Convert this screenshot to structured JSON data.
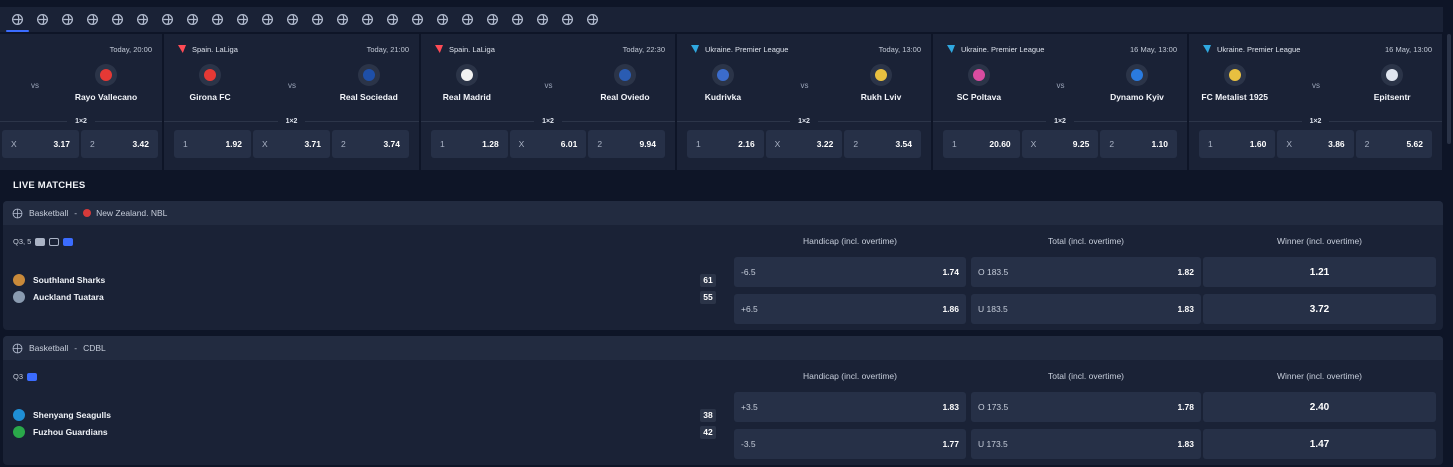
{
  "sports_bar": {
    "icons": [
      "soccer-icon",
      "basketball-icon",
      "tennis-icon",
      "ice-hockey-icon",
      "table-tennis-icon",
      "baseball-icon",
      "volleyball-icon",
      "american-football-icon",
      "handball-icon",
      "cricket-icon",
      "badminton-icon",
      "darts-icon",
      "rugby-icon",
      "boxing-icon",
      "futsal-icon",
      "water-polo-icon",
      "snooker-icon",
      "hockey-stick-icon",
      "golf-icon",
      "esports-icon",
      "chess-icon",
      "trophy-icon",
      "cycling-icon",
      "bicycle-icon"
    ]
  },
  "top_matches": [
    {
      "league": "",
      "date": "Today, 20:00",
      "home": "",
      "away": "Rayo Vallecano",
      "market": "1×2",
      "odds": [
        {
          "l": "X",
          "v": "3.17"
        },
        {
          "l": "2",
          "v": "3.42"
        }
      ],
      "home_color": "",
      "away_color": "#e53935",
      "league_color": ""
    },
    {
      "league": "Spain. LaLiga",
      "date": "Today, 21:00",
      "home": "Girona FC",
      "away": "Real Sociedad",
      "market": "1×2",
      "odds": [
        {
          "l": "1",
          "v": "1.92"
        },
        {
          "l": "X",
          "v": "3.71"
        },
        {
          "l": "2",
          "v": "3.74"
        }
      ],
      "home_color": "#e53935",
      "away_color": "#1e4fa8",
      "league_color": "#ff4b55"
    },
    {
      "league": "Spain. LaLiga",
      "date": "Today, 22:30",
      "home": "Real Madrid",
      "away": "Real Oviedo",
      "market": "1×2",
      "odds": [
        {
          "l": "1",
          "v": "1.28"
        },
        {
          "l": "X",
          "v": "6.01"
        },
        {
          "l": "2",
          "v": "9.94"
        }
      ],
      "home_color": "#f1f1f1",
      "away_color": "#2a5cb3",
      "league_color": "#ff4b55"
    },
    {
      "league": "Ukraine. Premier League",
      "date": "Today, 13:00",
      "home": "Kudrivka",
      "away": "Rukh Lviv",
      "market": "1×2",
      "odds": [
        {
          "l": "1",
          "v": "2.16"
        },
        {
          "l": "X",
          "v": "3.22"
        },
        {
          "l": "2",
          "v": "3.54"
        }
      ],
      "home_color": "#3b6ccc",
      "away_color": "#e8c040",
      "league_color": "#2fa8e0"
    },
    {
      "league": "Ukraine. Premier League",
      "date": "16 May, 13:00",
      "home": "SC Poltava",
      "away": "Dynamo Kyiv",
      "market": "1×2",
      "odds": [
        {
          "l": "1",
          "v": "20.60"
        },
        {
          "l": "X",
          "v": "9.25"
        },
        {
          "l": "2",
          "v": "1.10"
        }
      ],
      "home_color": "#d94ca0",
      "away_color": "#2a7be0",
      "league_color": "#2fa8e0"
    },
    {
      "league": "Ukraine. Premier League",
      "date": "16 May, 13:00",
      "home": "FC Metalist 1925",
      "away": "Epitsentr",
      "market": "1×2",
      "odds": [
        {
          "l": "1",
          "v": "1.60"
        },
        {
          "l": "X",
          "v": "3.86"
        },
        {
          "l": "2",
          "v": "5.62"
        }
      ],
      "home_color": "#e8c040",
      "away_color": "#e0e6f0",
      "league_color": "#2fa8e0"
    }
  ],
  "live": {
    "title": "LIVE MATCHES",
    "sections": [
      {
        "sport": "Basketball",
        "league": "New Zealand. NBL",
        "flag_color": "#d63a3a",
        "period": "Q3, 5",
        "columns": [
          "Handicap (incl. overtime)",
          "Total (incl. overtime)",
          "Winner (incl. overtime)"
        ],
        "teams": [
          {
            "name": "Southland Sharks",
            "score": "61",
            "color": "#c98a3a"
          },
          {
            "name": "Auckland Tuatara",
            "score": "55",
            "color": "#8a9bb0"
          }
        ],
        "handicap": [
          {
            "l": "-6.5",
            "v": "1.74"
          },
          {
            "l": "+6.5",
            "v": "1.86"
          }
        ],
        "total": [
          {
            "l": "O 183.5",
            "v": "1.82"
          },
          {
            "l": "U 183.5",
            "v": "1.83"
          }
        ],
        "winner": [
          "1.21",
          "3.72"
        ]
      },
      {
        "sport": "Basketball",
        "league": "CDBL",
        "flag_color": "",
        "period": "Q3",
        "columns": [
          "Handicap (incl. overtime)",
          "Total (incl. overtime)",
          "Winner (incl. overtime)"
        ],
        "teams": [
          {
            "name": "Shenyang Seagulls",
            "score": "38",
            "color": "#1f8fd6"
          },
          {
            "name": "Fuzhou Guardians",
            "score": "42",
            "color": "#2aa84a"
          }
        ],
        "handicap": [
          {
            "l": "+3.5",
            "v": "1.83"
          },
          {
            "l": "-3.5",
            "v": "1.77"
          }
        ],
        "total": [
          {
            "l": "O 173.5",
            "v": "1.78"
          },
          {
            "l": "U 173.5",
            "v": "1.83"
          }
        ],
        "winner": [
          "2.40",
          "1.47"
        ]
      }
    ]
  }
}
